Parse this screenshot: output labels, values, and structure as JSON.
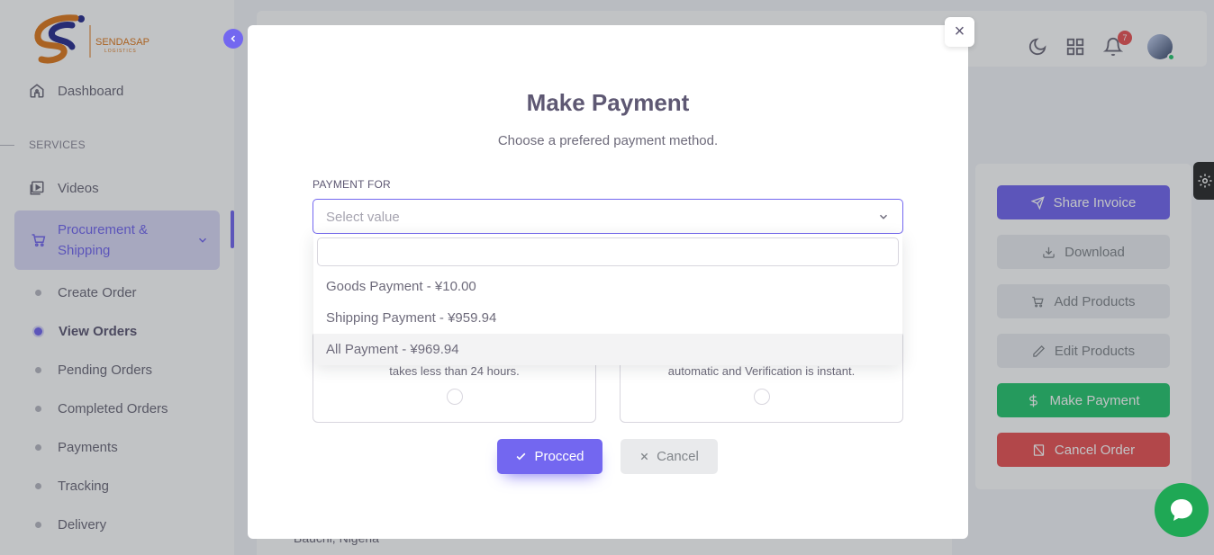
{
  "brand": {
    "name": "SENDASAP",
    "tagline": "LOGISTICS"
  },
  "sidebar": {
    "dashboard_label": "Dashboard",
    "section_label": "SERVICES",
    "videos_label": "Videos",
    "group_label": "Procurement & Shipping",
    "sub_items": [
      {
        "label": "Create Order",
        "active": false
      },
      {
        "label": "View Orders",
        "active": true
      },
      {
        "label": "Pending Orders",
        "active": false
      },
      {
        "label": "Completed Orders",
        "active": false
      },
      {
        "label": "Payments",
        "active": false
      },
      {
        "label": "Tracking",
        "active": false
      },
      {
        "label": "Delivery",
        "active": false
      }
    ]
  },
  "header": {
    "notification_count": "7"
  },
  "actions": {
    "share_invoice": "Share Invoice",
    "download": "Download",
    "add_products": "Add Products",
    "edit_products": "Edit Products",
    "make_payment": "Make Payment",
    "cancel_order": "Cancel Order"
  },
  "background": {
    "address_text": "Bauchi, Nigeria"
  },
  "modal": {
    "close_glyph": "×",
    "title": "Make Payment",
    "subtitle": "Choose a prefered payment method.",
    "field_label": "PAYMENT FOR",
    "select_placeholder": "Select value",
    "dropdown_options": [
      "Goods Payment - ¥10.00",
      "Shipping Payment - ¥959.94",
      "All Payment - ¥969.94"
    ],
    "method_left_desc": "takes less than 24 hours.",
    "method_right_desc": "automatic and Verification is instant.",
    "proceed_label": "Procced",
    "cancel_label": "Cancel"
  },
  "colors": {
    "primary": "#7367f0",
    "success": "#28c76f",
    "danger": "#ea5455",
    "chat": "#1fa855"
  }
}
